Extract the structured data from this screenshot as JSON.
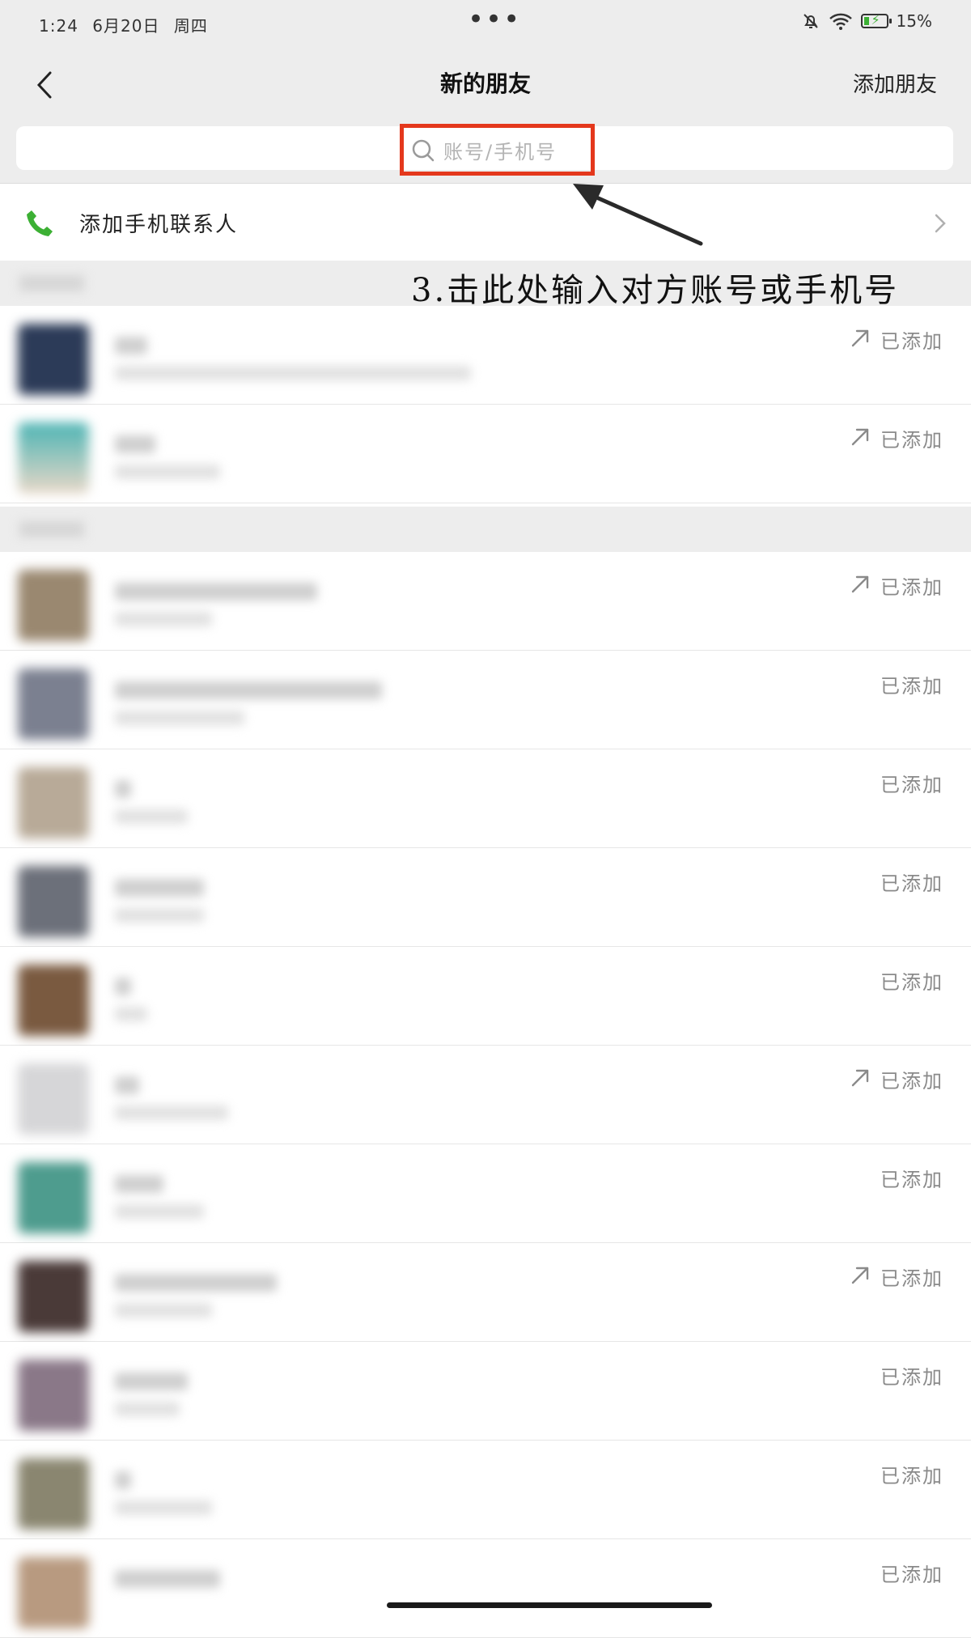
{
  "status_bar": {
    "time": "1:24",
    "date": "6月20日",
    "weekday": "周四",
    "more_dots": "•••",
    "battery": "15%",
    "battery_level_percent": 15
  },
  "nav": {
    "title": "新的朋友",
    "add_friend": "添加朋友"
  },
  "search": {
    "placeholder": "账号/手机号"
  },
  "phone_contacts": {
    "label": "添加手机联系人"
  },
  "annotation": "3.击此处输入对方账号或手机号",
  "friend_requests": [
    {
      "status": "已添加",
      "shared": true
    },
    {
      "status": "已添加",
      "shared": true
    },
    {
      "status": "已添加",
      "shared": true
    },
    {
      "status": "已添加",
      "shared": false
    },
    {
      "status": "已添加",
      "shared": false
    },
    {
      "status": "已添加",
      "shared": false
    },
    {
      "status": "已添加",
      "shared": false
    },
    {
      "status": "已添加",
      "shared": true
    },
    {
      "status": "已添加",
      "shared": false
    },
    {
      "status": "已添加",
      "shared": true
    },
    {
      "status": "已添加",
      "shared": false
    },
    {
      "status": "已添加",
      "shared": false
    },
    {
      "status": "已添加",
      "shared": false
    }
  ],
  "colors": {
    "nav_bg": "#ededed",
    "highlight_box": "#e4381c",
    "phone_icon": "#3cb034",
    "status_text": "#8a8a8a"
  }
}
